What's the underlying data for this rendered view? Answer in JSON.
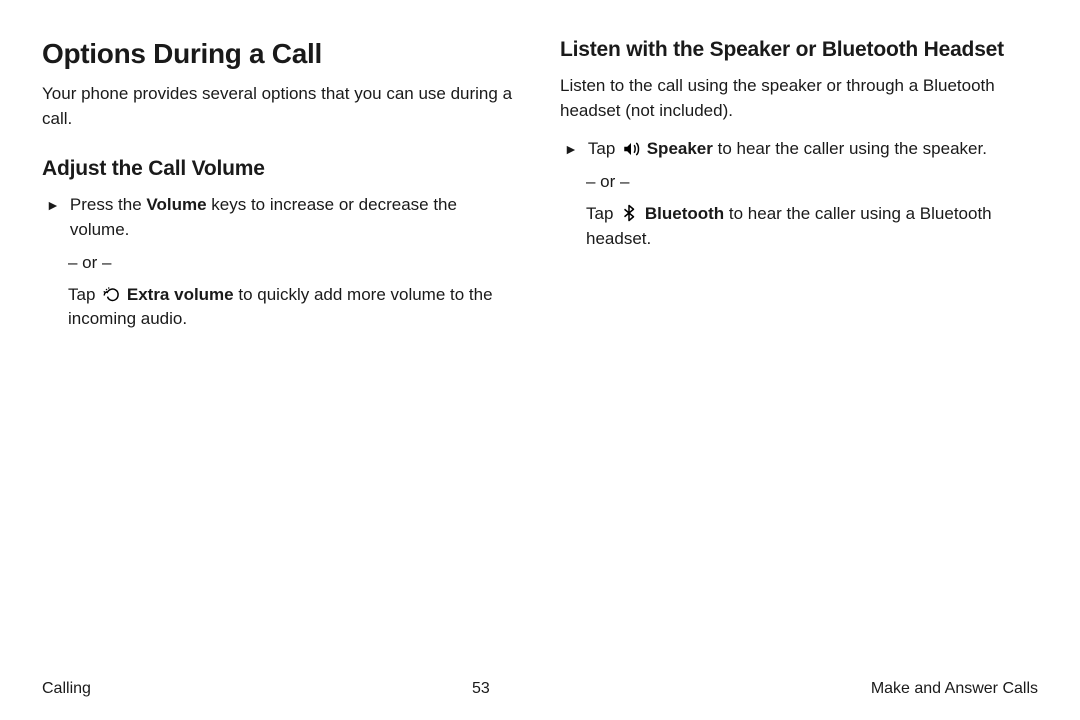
{
  "left": {
    "h1": "Options During a Call",
    "intro": "Your phone provides several options that you can use during a call.",
    "h2": "Adjust the Call Volume",
    "step1_a": "Press the ",
    "step1_bold": "Volume",
    "step1_b": " keys to increase or decrease the volume.",
    "or": "– or –",
    "step2_a": "Tap ",
    "step2_bold": " Extra volume",
    "step2_b": " to quickly add more volume to the incoming audio."
  },
  "right": {
    "h2": "Listen with the Speaker or Bluetooth Headset",
    "intro": "Listen to the call using the speaker or through a Bluetooth headset (not included).",
    "step1_a": "Tap ",
    "step1_bold": " Speaker",
    "step1_b": " to hear the caller using the speaker.",
    "or": "– or –",
    "step2_a": "Tap ",
    "step2_bold": " Bluetooth",
    "step2_b": " to hear the caller using a Bluetooth headset."
  },
  "footer": {
    "left": "Calling",
    "center": "53",
    "right": "Make and Answer Calls"
  }
}
